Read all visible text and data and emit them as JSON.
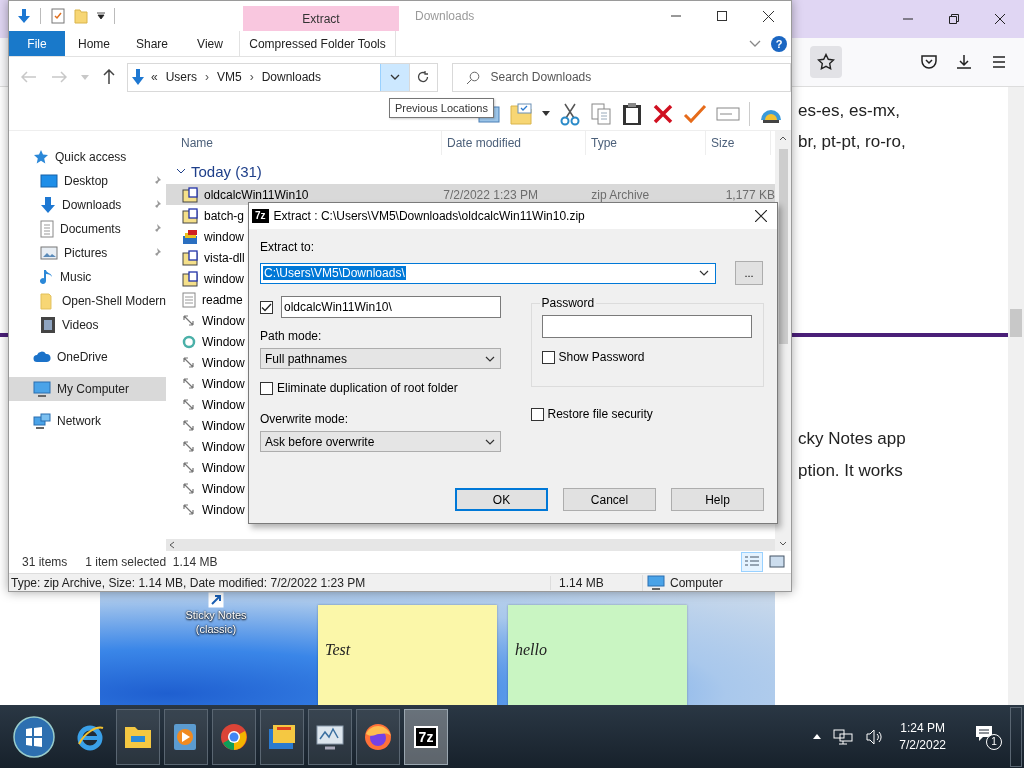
{
  "browser": {
    "lines_top": [
      "es-es, es-mx,",
      "br, pt-pt, ro-ro,"
    ],
    "lines_bottom": [
      "cky Notes app",
      "ption. It works"
    ],
    "screenshot": {
      "shortcut_label": "Sticky Notes (classic)",
      "notes": [
        {
          "text": "Test",
          "color": "#fbf7a9"
        },
        {
          "text": "hello",
          "color": "#c9f5c2"
        }
      ]
    }
  },
  "explorer": {
    "title": "Downloads",
    "context_tab": "Extract",
    "help_glyph": "?",
    "tabs": [
      {
        "label": "File",
        "kind": "file"
      },
      {
        "label": "Home",
        "kind": "plain"
      },
      {
        "label": "Share",
        "kind": "plain"
      },
      {
        "label": "View",
        "kind": "plain"
      },
      {
        "label": "Compressed Folder Tools",
        "kind": "context"
      }
    ],
    "address": {
      "prefix": "«",
      "crumbs": [
        "Users",
        "VM5",
        "Downloads"
      ],
      "separator": "›"
    },
    "search": {
      "placeholder": "Search Downloads"
    },
    "tooltip": "Previous Locations",
    "nav_pane": [
      {
        "label": "Quick access",
        "kind": "star",
        "selected": false,
        "children": [
          {
            "label": "Desktop",
            "kind": "desktop",
            "pinned": true,
            "selected": false
          },
          {
            "label": "Downloads",
            "kind": "download",
            "pinned": true,
            "selected": false
          },
          {
            "label": "Documents",
            "kind": "document",
            "pinned": true,
            "selected": false
          },
          {
            "label": "Pictures",
            "kind": "pictures",
            "pinned": true,
            "selected": false
          },
          {
            "label": "Music",
            "kind": "music",
            "pinned": false,
            "selected": false
          },
          {
            "label": "Open-Shell Modern",
            "kind": "folder",
            "pinned": false,
            "selected": false
          },
          {
            "label": "Videos",
            "kind": "video",
            "pinned": false,
            "selected": false
          }
        ]
      },
      {
        "label": "OneDrive",
        "kind": "cloud",
        "selected": false
      },
      {
        "label": "My Computer",
        "kind": "computer",
        "selected": true
      },
      {
        "label": "Network",
        "kind": "network",
        "selected": false
      }
    ],
    "columns": [
      "Name",
      "Date modified",
      "Type",
      "Size"
    ],
    "group": "Today (31)",
    "rows": [
      {
        "name": "oldcalcWin11Win10",
        "kind": "zip",
        "selected": true,
        "date": "7/2/2022 1:23 PM",
        "type": "zip Archive",
        "size": "1,177 KB"
      },
      {
        "name": "batch-g",
        "kind": "zip",
        "selected": false
      },
      {
        "name": "window",
        "kind": "archive",
        "selected": false
      },
      {
        "name": "vista-dll",
        "kind": "zip",
        "selected": false
      },
      {
        "name": "window",
        "kind": "zip",
        "selected": false
      },
      {
        "name": "readme",
        "kind": "text",
        "selected": false
      },
      {
        "name": "Window",
        "kind": "cursor",
        "selected": false
      },
      {
        "name": "Window",
        "kind": "busy",
        "selected": false
      },
      {
        "name": "Window",
        "kind": "cursor",
        "selected": false
      },
      {
        "name": "Window",
        "kind": "cursor",
        "selected": false
      },
      {
        "name": "Window",
        "kind": "cursor",
        "selected": false
      },
      {
        "name": "Window",
        "kind": "cursor",
        "selected": false
      },
      {
        "name": "Window",
        "kind": "cursor",
        "selected": false
      },
      {
        "name": "Window",
        "kind": "cursor",
        "selected": false
      },
      {
        "name": "Window",
        "kind": "cursor",
        "selected": false
      },
      {
        "name": "Window",
        "kind": "cursor",
        "selected": false
      }
    ],
    "status": {
      "items": "31 items",
      "selection": "1 item selected  1.14 MB"
    },
    "details": {
      "info": "Type: zip Archive, Size: 1.14 MB, Date modified: 7/2/2022 1:23 PM",
      "size": "1.14 MB",
      "location": "Computer"
    }
  },
  "dialog": {
    "logo": "7z",
    "title": "Extract : C:\\Users\\VM5\\Downloads\\oldcalcWin11Win10.zip",
    "extract_to_label": "Extract to:",
    "extract_to": {
      "value": "C:\\Users\\VM5\\Downloads\\",
      "highlighted": true
    },
    "browse": "...",
    "subfolder": {
      "checked": true,
      "value": "oldcalcWin11Win10\\"
    },
    "path_mode_label": "Path mode:",
    "path_mode": "Full pathnames",
    "eliminate": {
      "label": "Eliminate duplication of root folder",
      "checked": false
    },
    "overwrite_label": "Overwrite mode:",
    "overwrite": "Ask before overwrite",
    "password_label": "Password",
    "show_password": {
      "label": "Show Password",
      "checked": false
    },
    "restore": {
      "label": "Restore file security",
      "checked": false
    },
    "buttons": [
      {
        "label": "OK",
        "default": true
      },
      {
        "label": "Cancel",
        "default": false
      },
      {
        "label": "Help",
        "default": false
      }
    ]
  },
  "taskbar": {
    "apps": [
      {
        "kind": "ie",
        "running": false,
        "active": false
      },
      {
        "kind": "explorer",
        "running": true,
        "active": false
      },
      {
        "kind": "media",
        "running": true,
        "active": false
      },
      {
        "kind": "chrome",
        "running": true,
        "active": false
      },
      {
        "kind": "files",
        "running": true,
        "active": false
      },
      {
        "kind": "monitor",
        "running": true,
        "active": false
      },
      {
        "kind": "firefox",
        "running": true,
        "active": false
      },
      {
        "kind": "sevenzip",
        "running": true,
        "active": true,
        "label": "7z"
      }
    ],
    "time": "1:24 PM",
    "date": "7/2/2022",
    "notifications": "1"
  }
}
